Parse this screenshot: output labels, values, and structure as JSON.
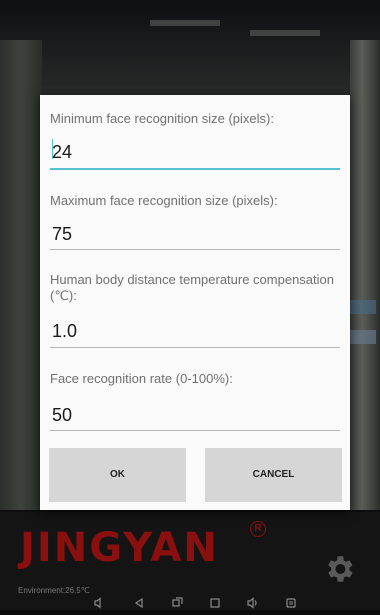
{
  "dialog": {
    "fields": [
      {
        "label": "Minimum face recognition size (pixels):",
        "value": "24"
      },
      {
        "label": "Maximum face recognition size (pixels):",
        "value": "75"
      },
      {
        "label": "Human body distance temperature compensation (℃):",
        "value": "1.0"
      },
      {
        "label": "Face recognition rate (0-100%):",
        "value": "50"
      }
    ],
    "ok_label": "OK",
    "cancel_label": "CANCEL"
  },
  "brand": {
    "name": "JINGYAN",
    "registered_mark": "R"
  },
  "status": {
    "environment": "Environment:26.5℃"
  },
  "icons": {
    "settings": "gear-icon",
    "nav": [
      "volume-down-icon",
      "back-icon",
      "screenshot-icon",
      "home-icon",
      "volume-up-icon",
      "recents-icon"
    ]
  },
  "colors": {
    "brand": "#8a1010",
    "accent": "#57c1cf",
    "dialog_bg": "#fafafa",
    "button_bg": "#d6d6d6"
  }
}
